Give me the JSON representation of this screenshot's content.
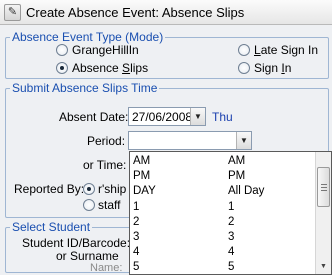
{
  "window": {
    "icon": "app-icon",
    "title": "Create Absence Event: Absence Slips"
  },
  "event_type": {
    "legend": "Absence Event Type (Mode)",
    "options": [
      {
        "label": "GrangeHillIn",
        "checked": false
      },
      {
        "label": "Late Sign In",
        "checked": false
      },
      {
        "label": "Absence Slips",
        "checked": true
      },
      {
        "label": "Sign In",
        "checked": false
      }
    ]
  },
  "submit": {
    "legend": "Submit Absence Slips Time",
    "absent_date_label": "Absent Date:",
    "absent_date_value": "27/06/2008",
    "absent_day": "Thu",
    "period_label": "Period:",
    "period_value": "",
    "or_time_label": "or Time:",
    "reported_by_label": "Reported By:",
    "reported_options": [
      {
        "label": "r'ship",
        "checked": true
      },
      {
        "label": "staff",
        "checked": false
      }
    ]
  },
  "select_student": {
    "legend": "Select Student",
    "id_label_line1": "Student ID/Barcode:",
    "id_label_line2": "or Surname",
    "name_label": "Name:"
  },
  "period_dropdown": {
    "items": [
      {
        "code": "AM",
        "desc": "AM"
      },
      {
        "code": "PM",
        "desc": "PM"
      },
      {
        "code": "DAY",
        "desc": "All Day"
      },
      {
        "code": "1",
        "desc": "1"
      },
      {
        "code": "2",
        "desc": "2"
      },
      {
        "code": "3",
        "desc": "3"
      },
      {
        "code": "4",
        "desc": "4"
      },
      {
        "code": "5",
        "desc": "5"
      }
    ]
  },
  "colors": {
    "legend_text": "#1a4fb0",
    "group_border": "#9fb6d3",
    "window_bg": "#eef0f3",
    "day_text": "#1a3fae"
  }
}
